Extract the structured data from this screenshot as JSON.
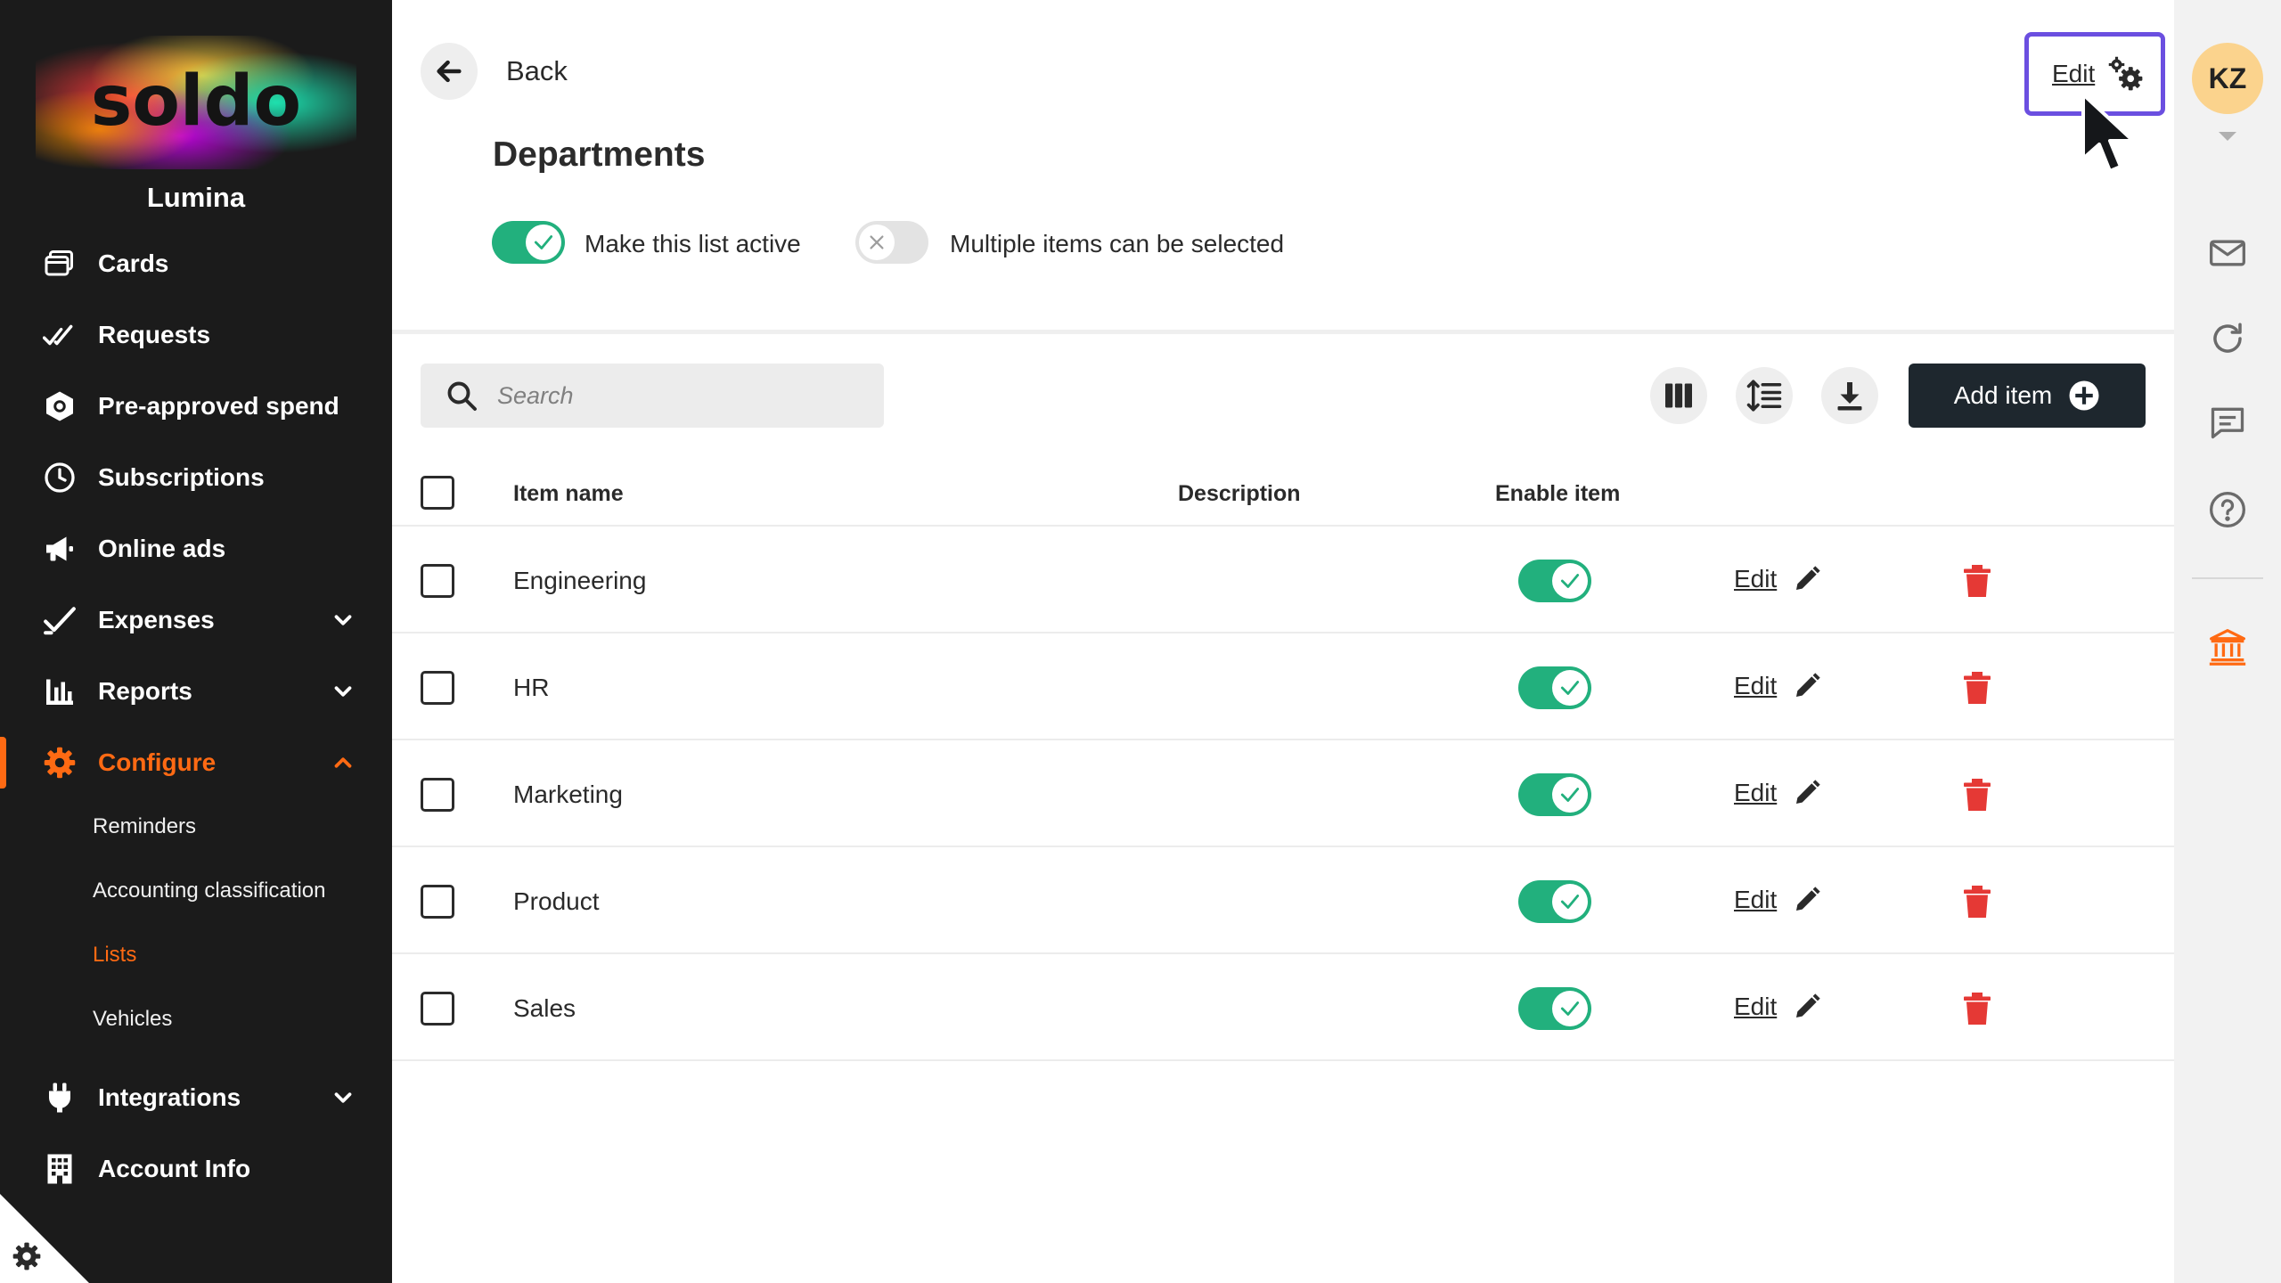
{
  "app": {
    "brand": "soldo",
    "org_name": "Lumina",
    "accent_color": "#ff6a13",
    "toggle_on_color": "#22b07d",
    "delete_color": "#e53935"
  },
  "sidebar": {
    "items": [
      {
        "label": "Cards",
        "icon": "cards-icon"
      },
      {
        "label": "Requests",
        "icon": "double-check-icon"
      },
      {
        "label": "Pre-approved spend",
        "icon": "hexagon-icon"
      },
      {
        "label": "Subscriptions",
        "icon": "clock-icon"
      },
      {
        "label": "Online ads",
        "icon": "megaphone-icon"
      },
      {
        "label": "Expenses",
        "icon": "check-icon",
        "expandable": true
      },
      {
        "label": "Reports",
        "icon": "bar-chart-icon",
        "expandable": true
      },
      {
        "label": "Configure",
        "icon": "gear-icon",
        "expandable": true,
        "expanded": true,
        "active": true
      },
      {
        "label": "Integrations",
        "icon": "plug-icon",
        "expandable": true
      },
      {
        "label": "Account Info",
        "icon": "building-icon"
      }
    ],
    "configure_sub": [
      {
        "label": "Reminders"
      },
      {
        "label": "Accounting classification"
      },
      {
        "label": "Lists",
        "active": true
      },
      {
        "label": "Vehicles"
      }
    ]
  },
  "header": {
    "back_label": "Back",
    "title": "Departments",
    "edit_label": "Edit",
    "active_toggle_label": "Make this list active",
    "active_toggle_on": true,
    "multi_toggle_label": "Multiple items can be selected",
    "multi_toggle_on": false
  },
  "toolbar": {
    "search_placeholder": "Search",
    "add_label": "Add item"
  },
  "table": {
    "columns": {
      "name": "Item name",
      "description": "Description",
      "enable": "Enable item"
    },
    "edit_label": "Edit",
    "rows": [
      {
        "name": "Engineering",
        "description": "",
        "enabled": true
      },
      {
        "name": "HR",
        "description": "",
        "enabled": true
      },
      {
        "name": "Marketing",
        "description": "",
        "enabled": true
      },
      {
        "name": "Product",
        "description": "",
        "enabled": true
      },
      {
        "name": "Sales",
        "description": "",
        "enabled": true
      }
    ]
  },
  "rail": {
    "avatar_initials": "KZ",
    "icons": [
      "mail-icon",
      "refresh-icon",
      "chat-icon",
      "help-icon",
      "bank-icon"
    ]
  }
}
